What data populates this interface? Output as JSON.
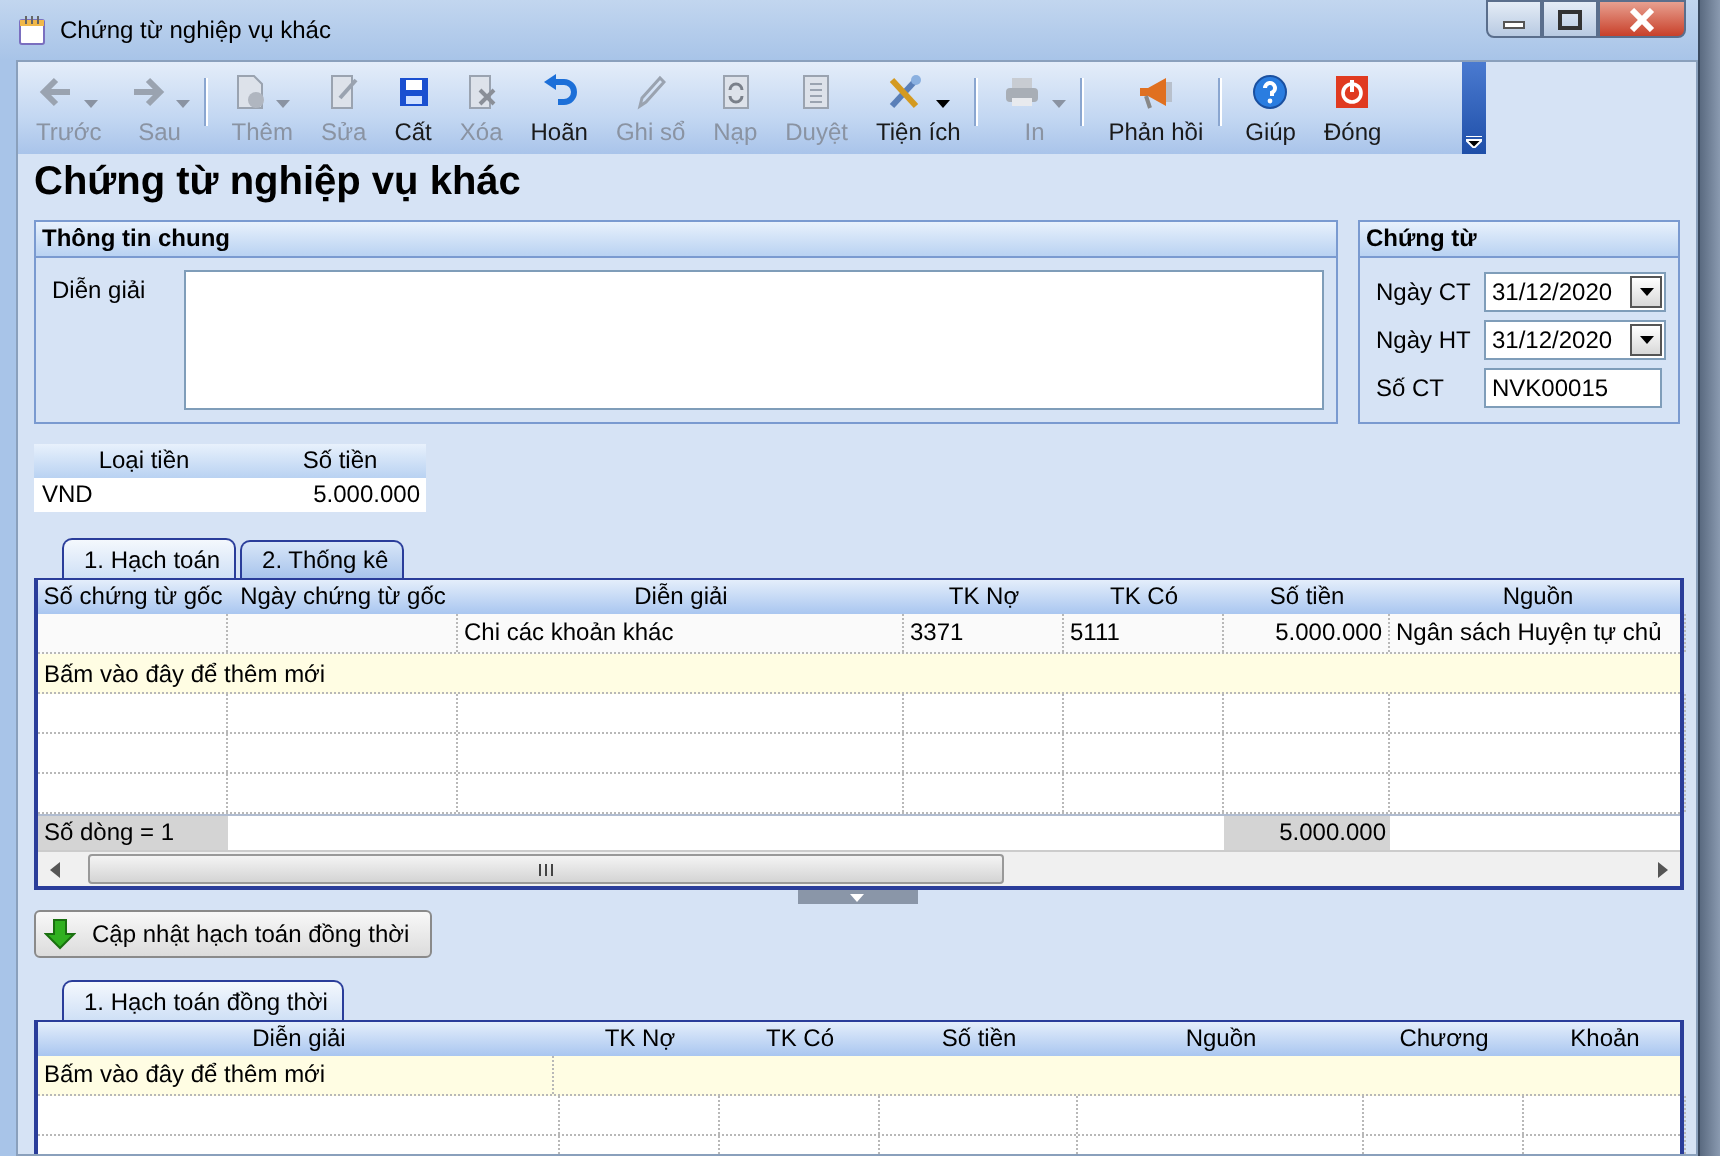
{
  "window": {
    "title": "Chứng từ nghiệp vụ khác"
  },
  "toolbar": [
    {
      "label": "Trước",
      "kind": "back",
      "enabled": false,
      "dropdown": true,
      "separator_after": false
    },
    {
      "label": "Sau",
      "kind": "forward",
      "enabled": false,
      "dropdown": true,
      "separator_after": true
    },
    {
      "label": "Thêm",
      "kind": "add",
      "enabled": false,
      "dropdown": true,
      "separator_after": false
    },
    {
      "label": "Sửa",
      "kind": "edit",
      "enabled": false,
      "dropdown": false,
      "separator_after": false
    },
    {
      "label": "Cất",
      "kind": "save",
      "enabled": true,
      "dropdown": false,
      "separator_after": false
    },
    {
      "label": "Xóa",
      "kind": "delete",
      "enabled": false,
      "dropdown": false,
      "separator_after": false
    },
    {
      "label": "Hoãn",
      "kind": "undo",
      "enabled": true,
      "dropdown": false,
      "separator_after": false
    },
    {
      "label": "Ghi sổ",
      "kind": "post",
      "enabled": false,
      "dropdown": false,
      "separator_after": false
    },
    {
      "label": "Nạp",
      "kind": "reload",
      "enabled": false,
      "dropdown": false,
      "separator_after": false
    },
    {
      "label": "Duyệt",
      "kind": "approve",
      "enabled": false,
      "dropdown": false,
      "separator_after": false
    },
    {
      "label": "Tiện ích",
      "kind": "tools",
      "enabled": true,
      "dropdown": true,
      "separator_after": true
    },
    {
      "label": "In",
      "kind": "print",
      "enabled": false,
      "dropdown": true,
      "separator_after": true
    },
    {
      "label": "Phản hồi",
      "kind": "feedback",
      "enabled": true,
      "dropdown": false,
      "separator_after": true
    },
    {
      "label": "Giúp",
      "kind": "help",
      "enabled": true,
      "dropdown": false,
      "separator_after": false
    },
    {
      "label": "Đóng",
      "kind": "close",
      "enabled": true,
      "dropdown": false,
      "separator_after": false
    }
  ],
  "heading": "Chứng từ nghiệp vụ khác",
  "general": {
    "title": "Thông tin chung",
    "description_label": "Diễn giải"
  },
  "voucher": {
    "title": "Chứng từ",
    "fields": [
      {
        "label": "Ngày CT",
        "value": "31/12/2020",
        "kind": "date"
      },
      {
        "label": "Ngày HT",
        "value": "31/12/2020",
        "kind": "date"
      },
      {
        "label": "Số CT",
        "value": "NVK00015",
        "kind": "text"
      }
    ]
  },
  "currency": {
    "columns": [
      "Loại tiền",
      "Số tiền"
    ],
    "row": [
      "VND",
      "5.000.000"
    ]
  },
  "tabs": [
    {
      "label": "1. Hạch toán",
      "selected": true
    },
    {
      "label": "2. Thống kê",
      "selected": false
    }
  ],
  "grid": {
    "columns": [
      {
        "title": "Số chứng từ gốc",
        "kind": "text"
      },
      {
        "title": "Ngày chứng từ gốc",
        "kind": "text"
      },
      {
        "title": "Diễn giải",
        "kind": "text"
      },
      {
        "title": "TK Nợ",
        "kind": "text"
      },
      {
        "title": "TK Có",
        "kind": "text"
      },
      {
        "title": "Số tiền",
        "kind": "number"
      },
      {
        "title": "Nguồn",
        "kind": "text"
      }
    ],
    "rows": [
      [
        "",
        "",
        "Chi các khoản khác",
        "3371",
        "5111",
        "5.000.000",
        "Ngân sách Huyện tự chủ"
      ]
    ],
    "new_row": "Bấm vào đây để thêm mới",
    "footer": {
      "count": "Số dòng = 1",
      "total": "5.000.000"
    }
  },
  "update_button": "Cập nhật hạch toán đồng thời",
  "tabs2": [
    {
      "label": "1. Hạch toán đồng thời",
      "selected": true
    }
  ],
  "grid2": {
    "columns": [
      "Diễn giải",
      "TK Nợ",
      "TK Có",
      "Số tiền",
      "Nguồn",
      "Chương",
      "Khoản"
    ],
    "new_row": "Bấm vào đây để thêm mới"
  }
}
